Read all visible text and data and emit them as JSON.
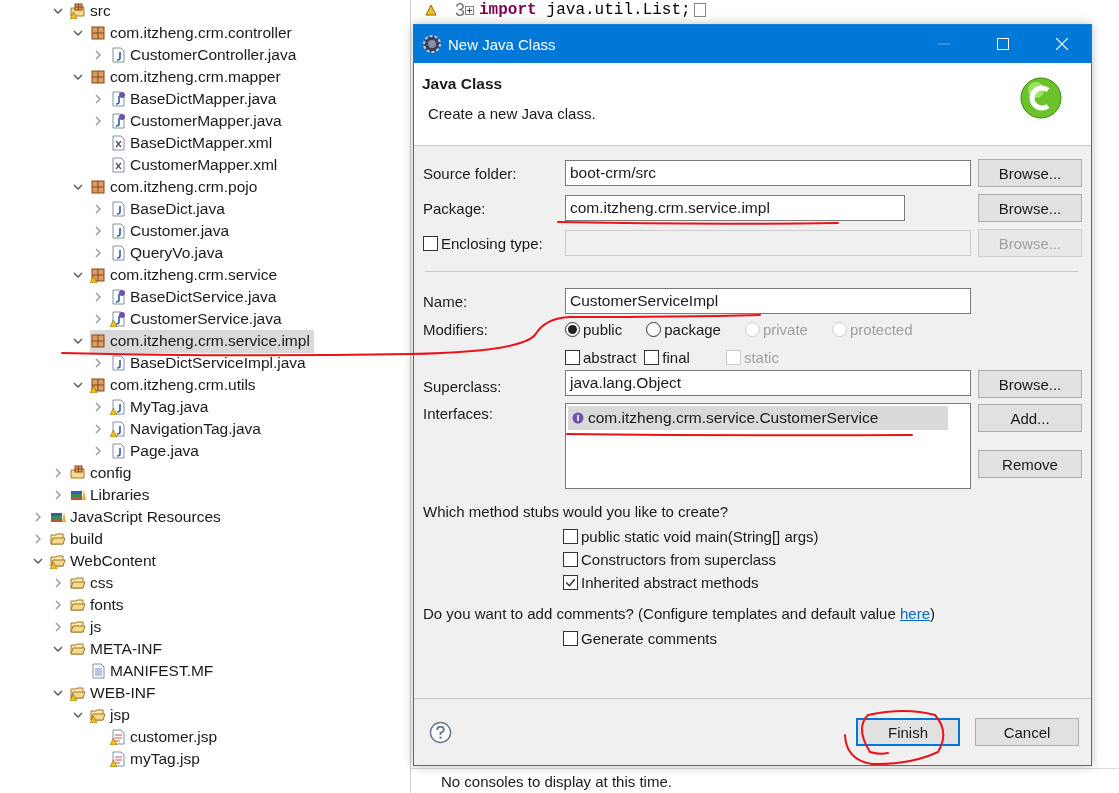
{
  "tree": {
    "scrolled_items": [
      {
        "label": "src",
        "kind": "source-folder",
        "warning": true,
        "expanded": true,
        "selected": false,
        "children": [
          {
            "label": "com.itzheng.crm.controller",
            "kind": "package",
            "warning": false,
            "expanded": true,
            "selected": false,
            "children": [
              {
                "label": "CustomerController.java",
                "kind": "class",
                "warning": false,
                "expanded": false,
                "selected": false
              }
            ]
          },
          {
            "label": "com.itzheng.crm.mapper",
            "kind": "package",
            "warning": false,
            "expanded": true,
            "selected": false,
            "children": [
              {
                "label": "BaseDictMapper.java",
                "kind": "interface",
                "warning": false,
                "expanded": false,
                "selected": false
              },
              {
                "label": "CustomerMapper.java",
                "kind": "interface",
                "warning": false,
                "expanded": false,
                "selected": false
              },
              {
                "label": "BaseDictMapper.xml",
                "kind": "xml",
                "warning": false,
                "selected": false
              },
              {
                "label": "CustomerMapper.xml",
                "kind": "xml",
                "warning": false,
                "selected": false
              }
            ]
          },
          {
            "label": "com.itzheng.crm.pojo",
            "kind": "package",
            "warning": false,
            "expanded": true,
            "selected": false,
            "children": [
              {
                "label": "BaseDict.java",
                "kind": "class",
                "warning": false,
                "expanded": false,
                "selected": false
              },
              {
                "label": "Customer.java",
                "kind": "class",
                "warning": false,
                "expanded": false,
                "selected": false
              },
              {
                "label": "QueryVo.java",
                "kind": "class",
                "warning": false,
                "expanded": false,
                "selected": false
              }
            ]
          },
          {
            "label": "com.itzheng.crm.service",
            "kind": "package",
            "warning": true,
            "expanded": true,
            "selected": false,
            "children": [
              {
                "label": "BaseDictService.java",
                "kind": "interface",
                "warning": false,
                "expanded": false,
                "selected": false
              },
              {
                "label": "CustomerService.java",
                "kind": "interface",
                "warning": true,
                "expanded": false,
                "selected": false
              }
            ]
          },
          {
            "label": "com.itzheng.crm.service.impl",
            "kind": "package",
            "warning": false,
            "expanded": true,
            "selected": true,
            "children": [
              {
                "label": "BaseDictServiceImpl.java",
                "kind": "class",
                "warning": false,
                "expanded": false,
                "selected": false
              }
            ]
          },
          {
            "label": "com.itzheng.crm.utils",
            "kind": "package",
            "warning": true,
            "expanded": true,
            "selected": false,
            "children": [
              {
                "label": "MyTag.java",
                "kind": "class",
                "warning": true,
                "expanded": false,
                "selected": false
              },
              {
                "label": "NavigationTag.java",
                "kind": "class",
                "warning": true,
                "expanded": false,
                "selected": false
              },
              {
                "label": "Page.java",
                "kind": "class",
                "warning": false,
                "expanded": false,
                "selected": false
              }
            ]
          }
        ]
      },
      {
        "label": "config",
        "kind": "source-folder",
        "warning": false,
        "expanded": false,
        "selected": false
      },
      {
        "label": "Libraries",
        "kind": "library",
        "warning": false,
        "expanded": false,
        "selected": false
      }
    ],
    "items": [
      {
        "label": "JavaScript Resources",
        "kind": "library",
        "warning": false,
        "expanded": false,
        "selected": false
      },
      {
        "label": "build",
        "kind": "folder",
        "warning": false,
        "expanded": false,
        "selected": false
      },
      {
        "label": "WebContent",
        "kind": "folder",
        "warning": true,
        "expanded": true,
        "selected": false,
        "children": [
          {
            "label": "css",
            "kind": "folder",
            "warning": false,
            "expanded": false,
            "selected": false
          },
          {
            "label": "fonts",
            "kind": "folder",
            "warning": false,
            "expanded": false,
            "selected": false
          },
          {
            "label": "js",
            "kind": "folder",
            "warning": false,
            "expanded": false,
            "selected": false
          },
          {
            "label": "META-INF",
            "kind": "folder",
            "warning": false,
            "expanded": true,
            "selected": false,
            "children": [
              {
                "label": "MANIFEST.MF",
                "kind": "text",
                "warning": false,
                "selected": false
              }
            ]
          },
          {
            "label": "WEB-INF",
            "kind": "folder",
            "warning": true,
            "expanded": true,
            "selected": false,
            "children": [
              {
                "label": "jsp",
                "kind": "folder",
                "warning": true,
                "expanded": true,
                "selected": false,
                "children": [
                  {
                    "label": "customer.jsp",
                    "kind": "jsp",
                    "warning": true,
                    "selected": false
                  },
                  {
                    "label": "myTag.jsp",
                    "kind": "jsp",
                    "warning": true,
                    "selected": false
                  }
                ]
              }
            ]
          }
        ]
      }
    ]
  },
  "editor": {
    "lines": [
      {
        "number": "3",
        "warning": true,
        "folded": true,
        "keyword": "import",
        "text": "java.util.List;"
      }
    ]
  },
  "console": {
    "message": "No consoles to display at this time."
  },
  "dialog": {
    "title": "New Java Class",
    "heading": "Java Class",
    "description": "Create a new Java class.",
    "source_folder": {
      "label": "Source folder:",
      "value": "boot-crm/src",
      "button": "Browse..."
    },
    "package": {
      "label": "Package:",
      "value": "com.itzheng.crm.service.impl",
      "button": "Browse..."
    },
    "enclosing_type": {
      "label": "Enclosing type:",
      "checked": false,
      "button": "Browse..."
    },
    "name": {
      "label": "Name:",
      "value": "CustomerServiceImpl"
    },
    "modifiers": {
      "label": "Modifiers:",
      "access": [
        {
          "label": "public",
          "selected": true,
          "disabled": false
        },
        {
          "label": "package",
          "selected": false,
          "disabled": false
        },
        {
          "label": "private",
          "selected": false,
          "disabled": true
        },
        {
          "label": "protected",
          "selected": false,
          "disabled": true
        }
      ],
      "flags": [
        {
          "label": "abstract",
          "checked": false,
          "disabled": false
        },
        {
          "label": "final",
          "checked": false,
          "disabled": false
        },
        {
          "label": "static",
          "checked": false,
          "disabled": true
        }
      ]
    },
    "superclass": {
      "label": "Superclass:",
      "value": "java.lang.Object",
      "button": "Browse..."
    },
    "interfaces": {
      "label": "Interfaces:",
      "items": [
        {
          "label": "com.itzheng.crm.service.CustomerService",
          "selected": true
        }
      ],
      "buttons": [
        "Add...",
        "Remove"
      ]
    },
    "stubs": {
      "question": "Which method stubs would you like to create?",
      "options": [
        {
          "label": "public static void main(String[] args)",
          "checked": false
        },
        {
          "label": "Constructors from superclass",
          "checked": false
        },
        {
          "label": "Inherited abstract methods",
          "checked": true
        }
      ]
    },
    "comments": {
      "question": "Do you want to add comments? (Configure templates and default value ",
      "link": "here",
      "closing": ")",
      "options": [
        {
          "label": "Generate comments",
          "checked": false
        }
      ]
    },
    "buttons": [
      {
        "label": "Finish",
        "default": true
      },
      {
        "label": "Cancel",
        "default": false
      }
    ]
  }
}
